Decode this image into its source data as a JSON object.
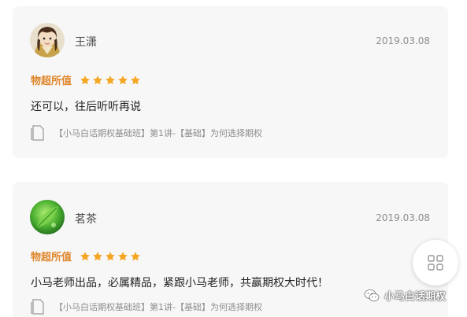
{
  "reviews": [
    {
      "username": "王潇",
      "date": "2019.03.08",
      "rating_label": "物超所值",
      "stars": 5,
      "comment": "还可以，往后听听再说",
      "source": "【小马白话期权基础班】第1讲-【基础】为何选择期权",
      "avatar": "anime-character-avatar"
    },
    {
      "username": "茗茶",
      "date": "2019.03.08",
      "rating_label": "物超所值",
      "stars": 5,
      "comment": "小马老师出品，必属精品，紧跟小马老师，共赢期权大时代！",
      "source": "【小马白话期权基础班】第1讲-【基础】为何选择期权",
      "avatar": "green-leaf-avatar"
    }
  ],
  "watermark": {
    "text": "小马白话期权",
    "icon": "wechat-icon"
  },
  "fab": {
    "icon": "grid-menu-icon"
  },
  "colors": {
    "accent": "#e0862a",
    "star": "#f5a623",
    "card_bg": "#f7f7f8"
  }
}
